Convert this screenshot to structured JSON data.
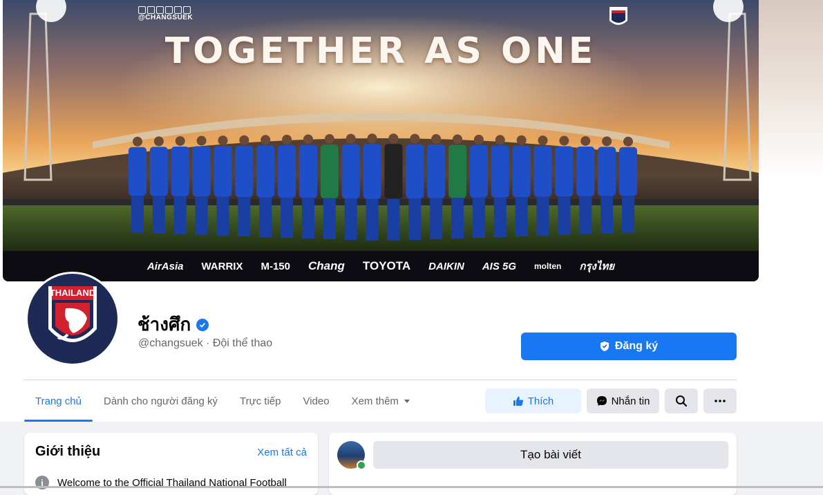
{
  "cover": {
    "title": "TOGETHER AS ONE",
    "handle": "@CHANGSUEK",
    "sponsors": [
      "AirAsia",
      "WARRIX",
      "M-150",
      "Chang",
      "TOYOTA",
      "DAIKIN",
      "AIS 5G",
      "molten",
      "กรุงไทย"
    ]
  },
  "avatar": {
    "word": "THAILAND"
  },
  "profile": {
    "name": "ช้างศึก",
    "subtitle": "@changsuek · Đội thể thao",
    "subscribe_label": "Đăng ký"
  },
  "tabs": [
    {
      "label": "Trang chủ",
      "active": true
    },
    {
      "label": "Dành cho người đăng ký",
      "active": false
    },
    {
      "label": "Trực tiếp",
      "active": false
    },
    {
      "label": "Video",
      "active": false
    },
    {
      "label": "Xem thêm",
      "active": false
    }
  ],
  "actions": {
    "like_label": "Thích",
    "message_label": "Nhắn tin",
    "search_icon": "search-icon",
    "more_icon": "more-icon"
  },
  "intro": {
    "title": "Giới thiệu",
    "see_all": "Xem tất cả",
    "text": "Welcome to the Official Thailand National Football"
  },
  "composer": {
    "create_post_label": "Tạo bài viết"
  },
  "colors": {
    "accent": "#1877f2",
    "jersey": "#1f4fc8",
    "background": "#f0f2f5"
  }
}
